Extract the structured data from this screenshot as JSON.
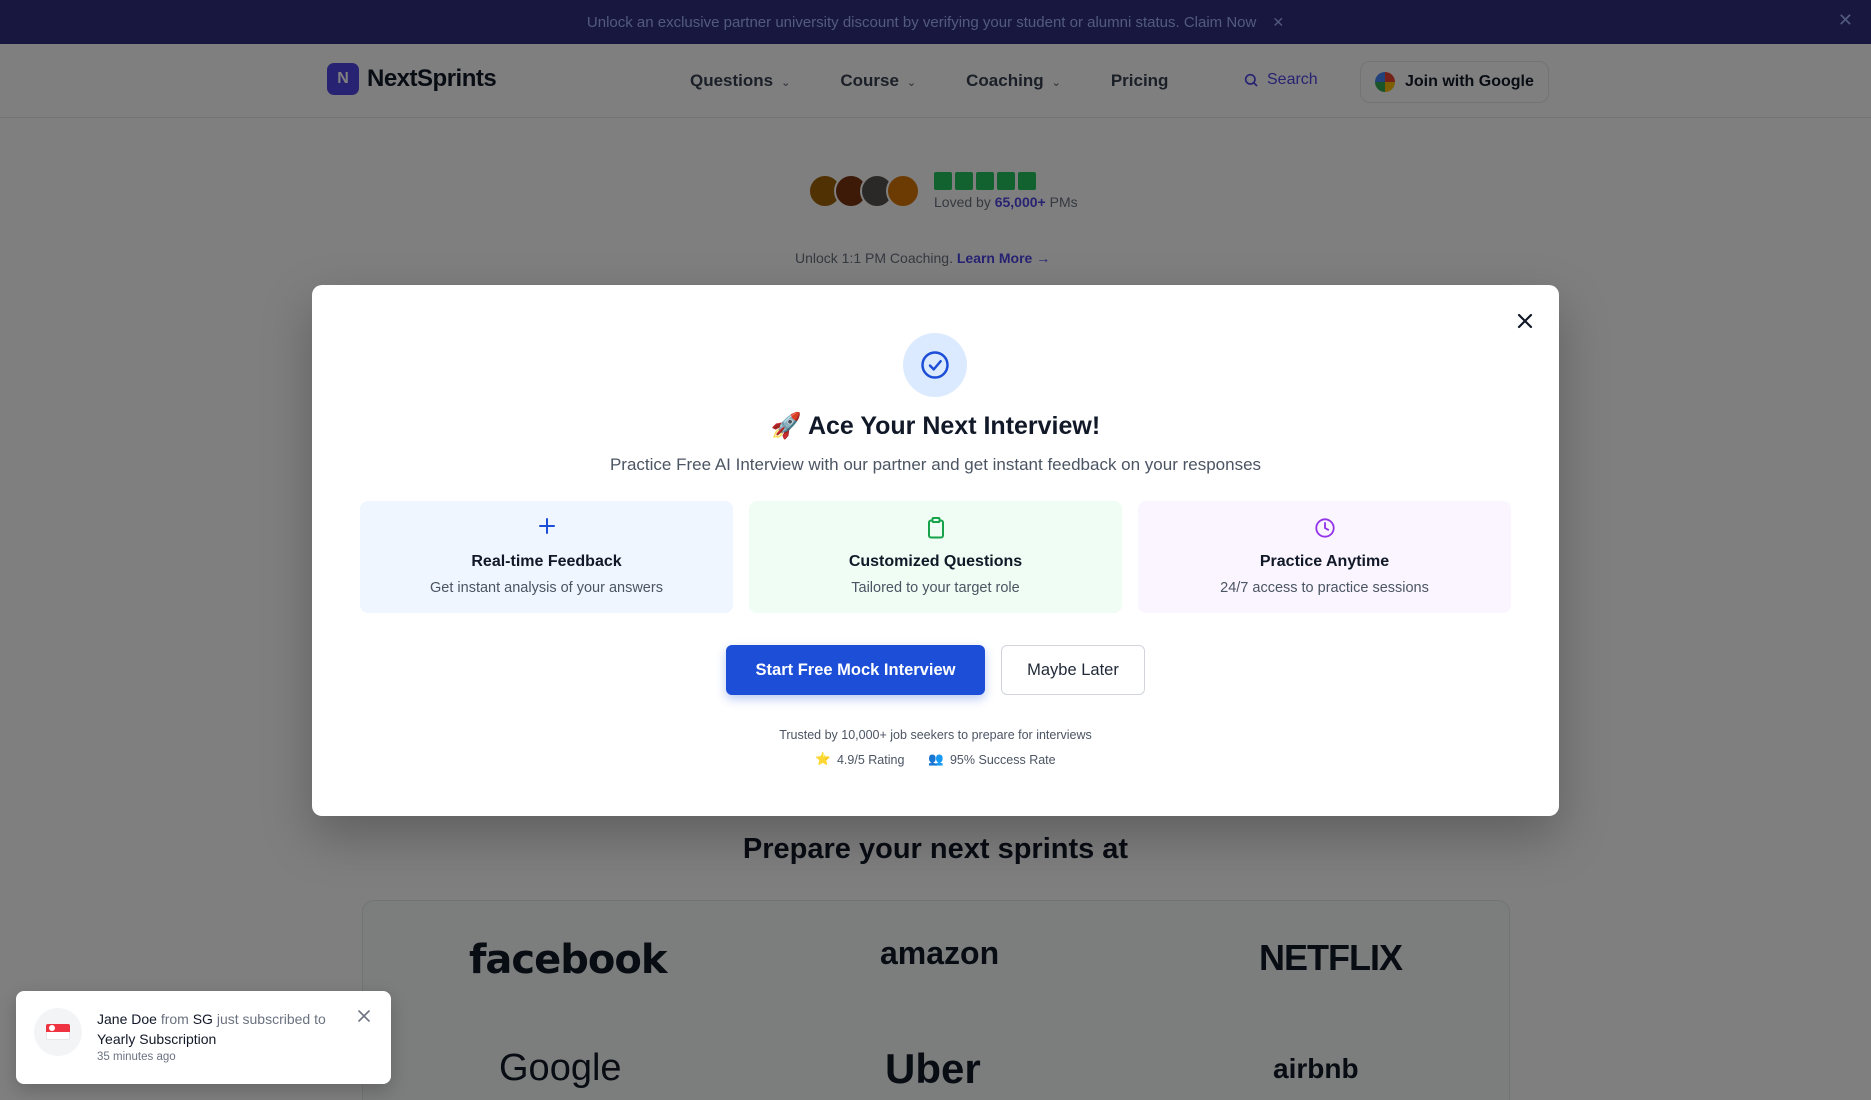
{
  "banner": {
    "text": "Unlock an exclusive partner university discount by verifying your student or alumni status. Claim Now",
    "close_glyph": "✕"
  },
  "nav": {
    "logo_text": "NextSprints",
    "logo_mark": "N",
    "links": [
      "Questions",
      "Course",
      "Coaching",
      "Pricing"
    ],
    "search_label": "Search",
    "join_label": "Join with Google"
  },
  "hero": {
    "rating_prefix": "Loved by",
    "rating_count": "65,000+",
    "rating_suffix": "PMs",
    "promo_text": "Unlock 1:1 PM Coaching.",
    "promo_link": "Learn More →"
  },
  "modal": {
    "title": "🚀 Ace Your Next Interview!",
    "subtitle": "Practice Free AI Interview with our partner and get instant feedback on your responses",
    "features": [
      {
        "title": "Real-time Feedback",
        "desc": "Get instant analysis of your answers",
        "icon": "plus-icon"
      },
      {
        "title": "Customized Questions",
        "desc": "Tailored to your target role",
        "icon": "clipboard-icon"
      },
      {
        "title": "Practice Anytime",
        "desc": "24/7 access to practice sessions",
        "icon": "clock-icon"
      }
    ],
    "primary_button": "Start Free Mock Interview",
    "secondary_button": "Maybe Later",
    "trust_text": "Trusted by 10,000+ job seekers to prepare for interviews",
    "stats": [
      {
        "icon": "⭐",
        "label": "4.9/5 Rating"
      },
      {
        "icon": "👥",
        "label": "95% Success Rate"
      }
    ]
  },
  "companies": {
    "title": "Prepare your next sprints at",
    "logos": [
      "facebook",
      "amazon",
      "NETFLIX",
      "Google",
      "Uber",
      "airbnb"
    ]
  },
  "toast": {
    "name": "Jane Doe",
    "from_word": "from",
    "country": "SG",
    "action": "just subscribed",
    "to_word": "to",
    "plan": "Yearly Subscription",
    "time": "35 minutes ago"
  },
  "colors": {
    "primary": "#1d4ed8",
    "banner": "#312e81",
    "feature_blue_bg": "#eff6ff",
    "feature_green_bg": "#f0fdf4",
    "feature_purple_bg": "#faf5ff"
  }
}
